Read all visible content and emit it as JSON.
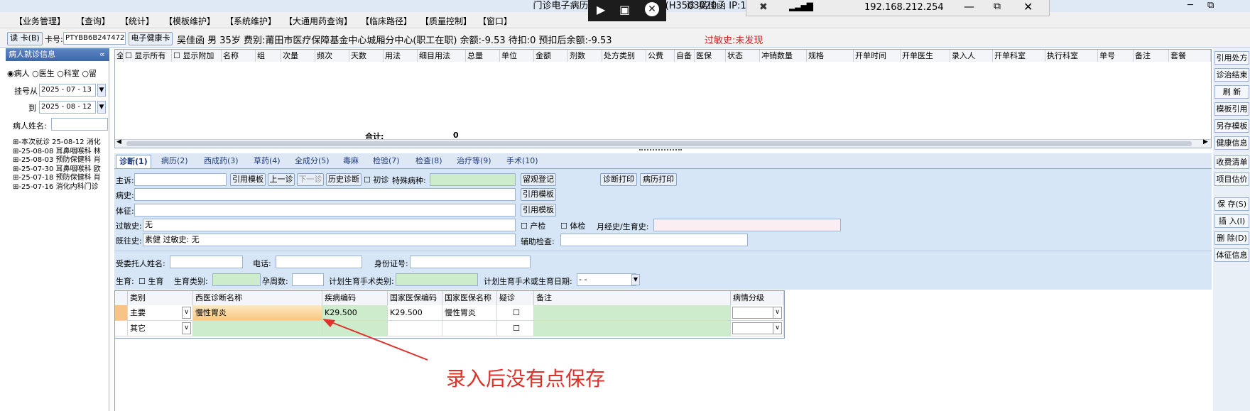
{
  "window": {
    "title": "门诊电子病历  莆田市城厢区医院(H3503020",
    "title_tail": "诊  吴佳函 IP:192"
  },
  "overlay": {
    "ip": "192.168.212.254"
  },
  "menu": [
    "【业务管理】",
    "【查询】",
    "【统计】",
    "【模板维护】",
    "【系统维护】",
    "【大通用药查询】",
    "【临床路径】",
    "【质量控制】",
    "【窗口】"
  ],
  "patient": {
    "read_card": "读 卡(B)",
    "card_label": "卡号:",
    "card_no": "PTYBB6B247472",
    "ehealth": "电子健康卡",
    "info": "吴佳函  男  35岁  费别:莆田市医疗保障基金中心城厢分中心(职工在职)  余额:-9.53  待扣:0  预扣后余额:-9.53",
    "allergy": "过敏史:未发现"
  },
  "left": {
    "header": "病人就诊信息",
    "radios": [
      "病人",
      "医生",
      "科室",
      "留"
    ],
    "from_label": "挂号从",
    "from_date": "2025 - 07 - 13",
    "to_label": "到",
    "to_date": "2025 - 08 - 12",
    "name_label": "病人姓名:",
    "tree": [
      "本次就诊 25-08-12 消化",
      "25-08-08 耳鼻咽喉科 林",
      "25-08-03 预防保健科 肖",
      "25-07-30 耳鼻咽喉科 欧",
      "25-07-18 预防保健科 肖",
      "25-07-16 消化内科门诊"
    ]
  },
  "grid": {
    "headers": [
      "全",
      "显示所有",
      "显示附加",
      "名称",
      "组",
      "次量",
      "频次",
      "天数",
      "用法",
      "细目用法",
      "总量",
      "单位",
      "金额",
      "剂数",
      "处方类别",
      "公费",
      "自备",
      "医保",
      "状态",
      "冲销数量",
      "规格",
      "开单时间",
      "开单医生",
      "录入人",
      "开单科室",
      "执行科室",
      "单号",
      "备注",
      "套餐"
    ],
    "total_label": "合计:",
    "total_value": "0"
  },
  "right_buttons": [
    "引用处方",
    "诊治结束",
    "刷  新",
    "模板引用",
    "另存模板",
    "健康信息",
    "收费清单",
    "项目估价",
    "保 存(S)",
    "插 入(I)",
    "删 除(D)",
    "体征信息"
  ],
  "tabs": [
    "诊断(1)",
    "病历(2)",
    "西成药(3)",
    "草药(4)",
    "全成分(5)",
    "毒麻",
    "检验(7)",
    "检查(8)",
    "治疗等(9)",
    "手术(10)"
  ],
  "form": {
    "zhusu": "主诉:",
    "yinyong": "引用模板",
    "shangyi": "上一诊",
    "xiayi": "下一诊",
    "lishi": "历史诊断",
    "chuzhen": "初诊",
    "teshu": "特殊病种:",
    "liuguan": "留观登记",
    "zhenduan_print": "诊断打印",
    "bingli_print": "病历打印",
    "bingshi": "病史:",
    "tizheng": "体征:",
    "guomin_label": "过敏史:",
    "guomin_value": "无",
    "chanjian": "产检",
    "tijian": "体检",
    "yuejing": "月经史/生育史:",
    "jiwang_label": "既往史:",
    "jiwang_value": "素健  过敏史: 无",
    "fuzhu": "辅助检查:",
    "weituo": "受委托人姓名:",
    "dianhua": "电话:",
    "shenfen": "身份证号:",
    "shengyu": "生育:",
    "shengyu_cb": "生育",
    "shengyu_lei": "生育类别:",
    "yunzhou": "孕周数:",
    "jihua_lei": "计划生育手术类别:",
    "jihua_date_label": "计划生育手术或生育日期:",
    "jihua_date": "-   -"
  },
  "diag": {
    "headers": [
      "类别",
      "西医诊断名称",
      "疾病编码",
      "国家医保编码",
      "国家医保名称",
      "疑诊",
      "备注",
      "病情分级"
    ],
    "rows": [
      {
        "type": "主要",
        "name": "慢性胃炎",
        "code": "K29.500",
        "gb_code": "K29.500",
        "gb_name": "慢性胃炎"
      },
      {
        "type": "其它",
        "name": "",
        "code": "",
        "gb_code": "",
        "gb_name": ""
      }
    ]
  },
  "annotation": "录入后没有点保存",
  "colors": {
    "annotation": "#e0302a",
    "header": "#4a72b8"
  }
}
